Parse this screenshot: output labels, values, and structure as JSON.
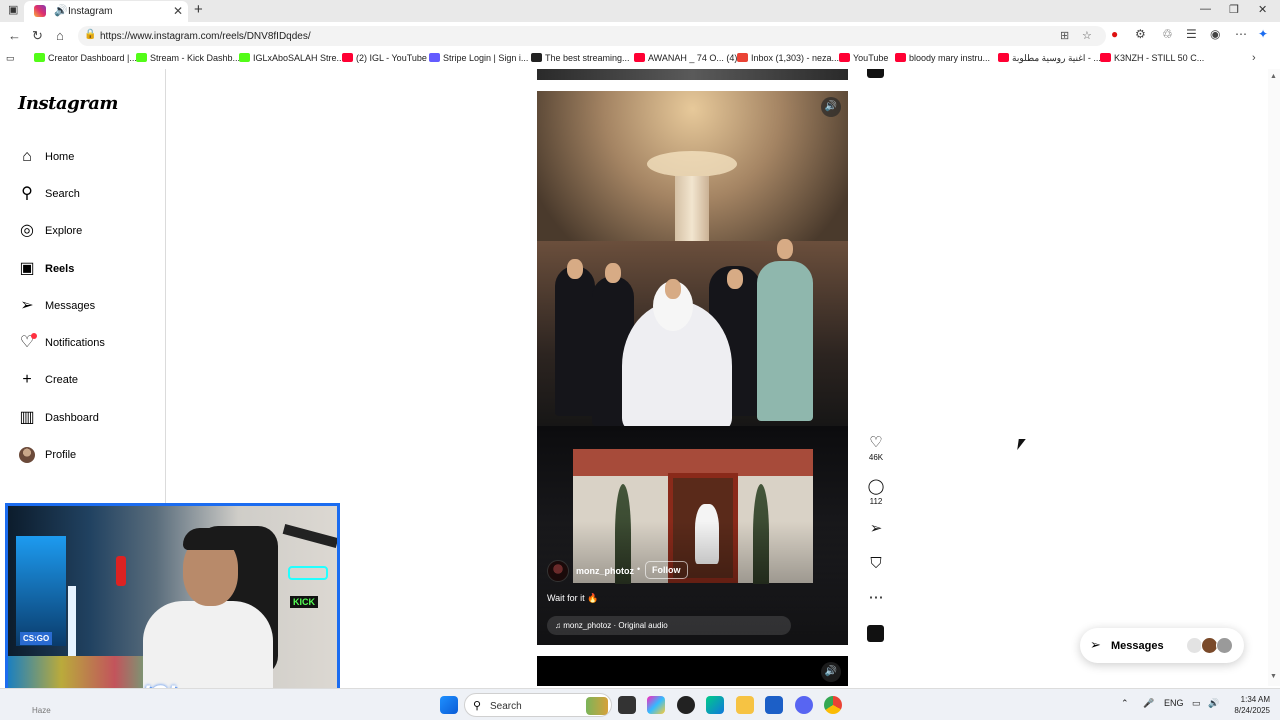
{
  "browser": {
    "tab_title": "Instagram",
    "url": "https://www.instagram.com/reels/DNV8fIDqdes/",
    "new_tab_symbol": "+",
    "bookmarks": [
      {
        "label": "Creator Dashboard |...",
        "color": "#53fc18"
      },
      {
        "label": "Stream - Kick Dashb...",
        "color": "#53fc18"
      },
      {
        "label": "IGLxAboSALAH Stre...",
        "color": "#53fc18"
      },
      {
        "label": "(2) IGL - YouTube",
        "color": "#ff0033"
      },
      {
        "label": "Stripe Login | Sign i...",
        "color": "#635bff"
      },
      {
        "label": "The best streaming...",
        "color": "#222222"
      },
      {
        "label": "AWANAH _ 74 O... (4)",
        "color": "#ff0033"
      },
      {
        "label": "Inbox (1,303) - neza...",
        "color": "#ea4335"
      },
      {
        "label": "YouTube",
        "color": "#ff0033"
      },
      {
        "label": "bloody mary instru...",
        "color": "#ff0033"
      },
      {
        "label": "اغنية روسية مطلوبة - ...",
        "color": "#ff0033"
      },
      {
        "label": "K3NZH - STILL 50 C...",
        "color": "#ff0033"
      }
    ]
  },
  "sidebar": {
    "logo": "Instagram",
    "items": [
      {
        "label": "Home",
        "icon": "home-icon",
        "glyph": "⌂"
      },
      {
        "label": "Search",
        "icon": "search-icon",
        "glyph": "⚲"
      },
      {
        "label": "Explore",
        "icon": "compass-icon",
        "glyph": "◎"
      },
      {
        "label": "Reels",
        "icon": "reels-icon",
        "glyph": "▣"
      },
      {
        "label": "Messages",
        "icon": "messages-icon",
        "glyph": "➢"
      },
      {
        "label": "Notifications",
        "icon": "heart-icon",
        "glyph": "♡"
      },
      {
        "label": "Create",
        "icon": "plus-icon",
        "glyph": "+"
      },
      {
        "label": "Dashboard",
        "icon": "dashboard-icon",
        "glyph": "▥"
      },
      {
        "label": "Profile",
        "icon": "profile-avatar",
        "glyph": ""
      }
    ]
  },
  "reel": {
    "username": "monz_photoz",
    "separator": "•",
    "follow_label": "Follow",
    "caption": "Wait for it 🔥",
    "audio": "♫ monz_photoz · Original audio"
  },
  "actions": {
    "likes": "46K",
    "comments": "112"
  },
  "messages_pill": {
    "label": "Messages"
  },
  "webcam": {
    "badge": "IGL",
    "tag": "CS:GO",
    "sign": "KICK"
  },
  "taskbar": {
    "search_placeholder": "Search",
    "language": "ENG",
    "time": "1:34 AM",
    "date": "8/24/2025",
    "user_label": "Haze"
  }
}
